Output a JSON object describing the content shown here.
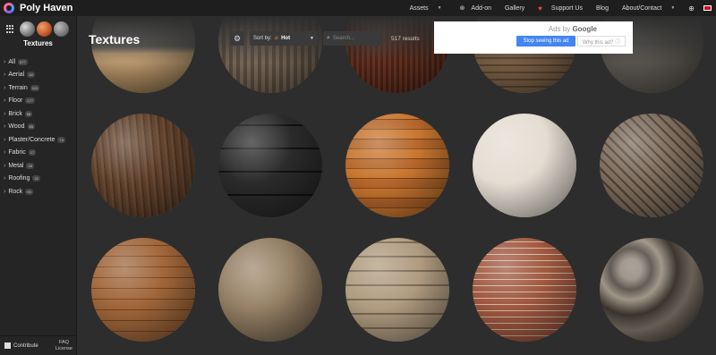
{
  "topbar": {
    "brand": "Poly Haven",
    "nav": [
      {
        "label": "Assets",
        "dropdown": true
      },
      {
        "label": "Add-on"
      },
      {
        "label": "Gallery"
      },
      {
        "label": "Support Us"
      },
      {
        "label": "Blog"
      },
      {
        "label": "About/Contact",
        "dropdown": true
      }
    ],
    "icons": [
      "login-icon",
      "uk-flag-icon"
    ]
  },
  "sidebar": {
    "title": "Textures",
    "categories": [
      {
        "label": "All",
        "count": "577"
      },
      {
        "label": "Aerial",
        "count": "18"
      },
      {
        "label": "Terrain",
        "count": "101"
      },
      {
        "label": "Floor",
        "count": "177"
      },
      {
        "label": "Brick",
        "count": "86"
      },
      {
        "label": "Wood",
        "count": "65"
      },
      {
        "label": "Plaster/Concrete",
        "count": "74"
      },
      {
        "label": "Fabric",
        "count": "17"
      },
      {
        "label": "Metal",
        "count": "16"
      },
      {
        "label": "Roofing",
        "count": "21"
      },
      {
        "label": "Rock",
        "count": "94"
      }
    ],
    "footer": {
      "contribute": "Contribute",
      "faq": "FAQ",
      "license": "License"
    }
  },
  "main": {
    "title": "Textures",
    "sort_label": "Sort by:",
    "sort_value": "Hot",
    "search_placeholder": "Search...",
    "results": "517 results"
  },
  "ad": {
    "ads_by": "Ads by",
    "google": "Google",
    "stop": "Stop seeing this ad",
    "why": "Why this ad? ⓘ"
  },
  "colors": {
    "accent": "#4285f4",
    "heart": "#e74c3c",
    "flame": "#f39c12"
  }
}
